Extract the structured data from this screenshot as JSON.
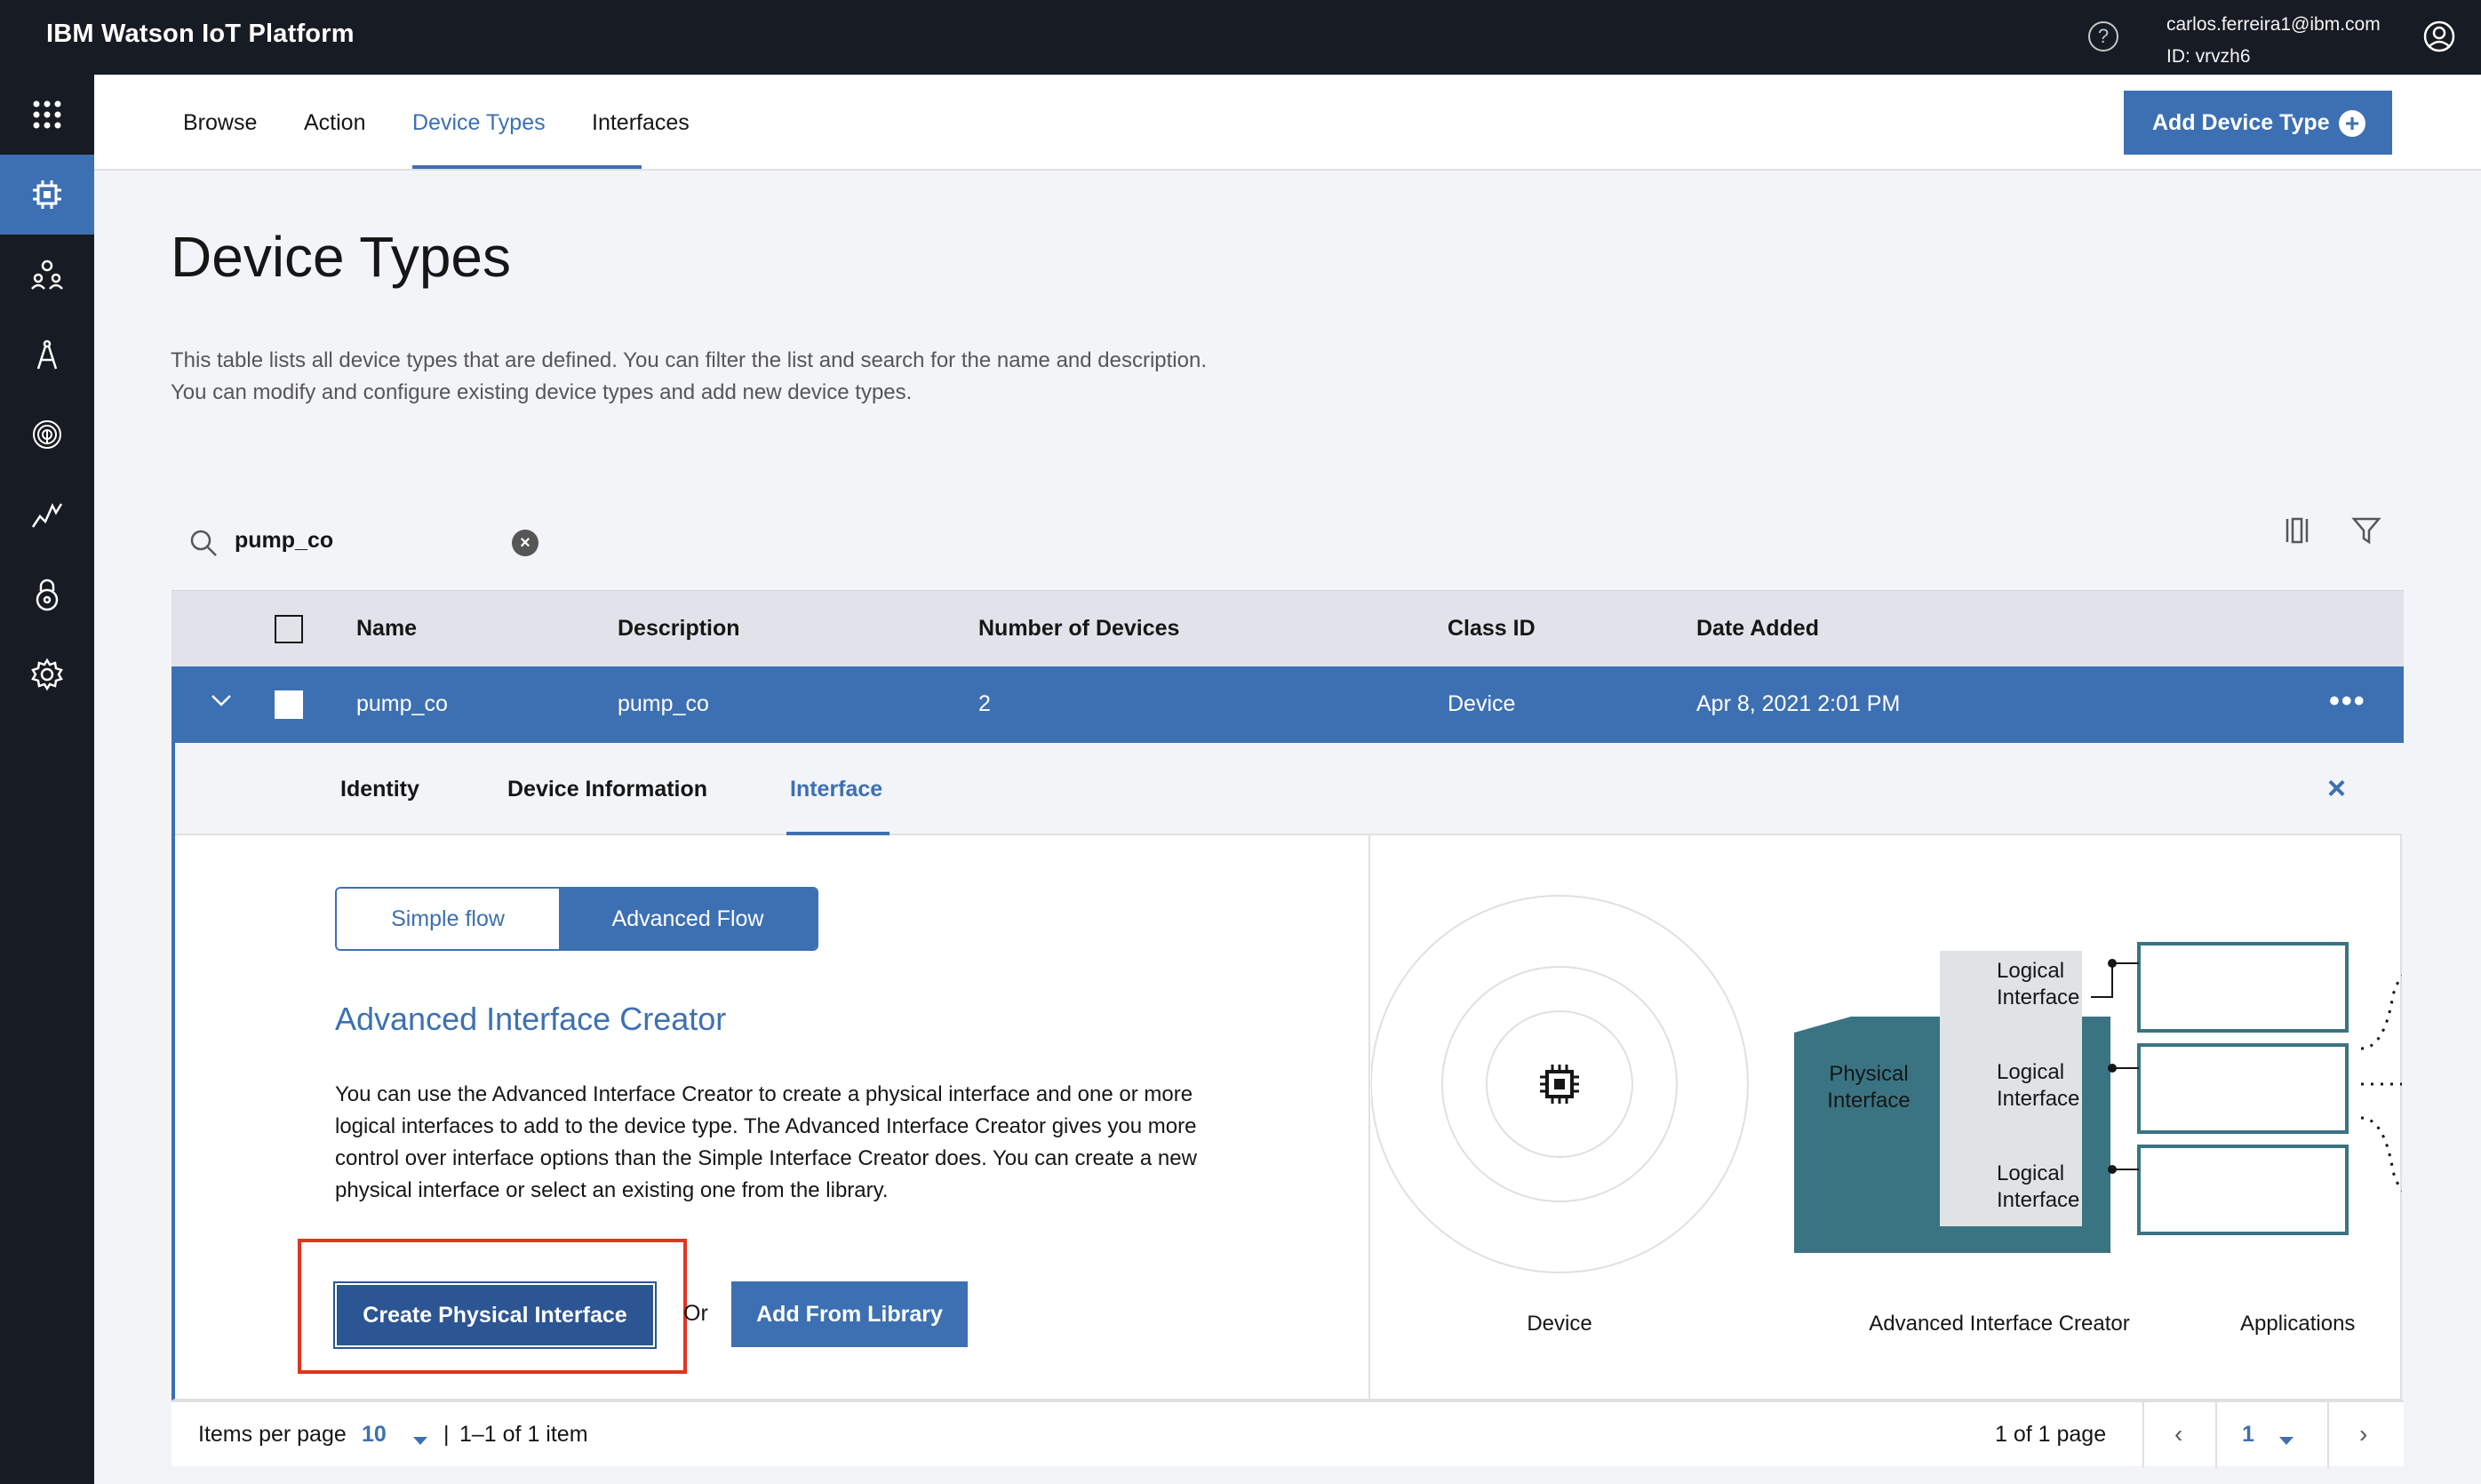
{
  "header": {
    "brand": "IBM Watson IoT Platform",
    "help_icon": "?",
    "user_email": "carlos.ferreira1@ibm.com",
    "user_id": "ID: vrvzh6"
  },
  "rail": {
    "items": [
      "apps-grid-icon",
      "devices-chip-icon",
      "members-icon",
      "apps-compass-icon",
      "security-fingerprint-icon",
      "usage-chart-icon",
      "lock-icon",
      "settings-gear-icon"
    ]
  },
  "subnav": {
    "tabs": [
      {
        "label": "Browse"
      },
      {
        "label": "Action"
      },
      {
        "label": "Device Types"
      },
      {
        "label": "Interfaces"
      }
    ],
    "add_button": "Add Device Type"
  },
  "page": {
    "title": "Device Types",
    "description_line1": "This table lists all device types that are defined. You can filter the list and search for the name and description.",
    "description_line2": "You can modify and configure existing device types and add new device types."
  },
  "search": {
    "value": "pump_co"
  },
  "table": {
    "headers": [
      "Name",
      "Description",
      "Number of Devices",
      "Class ID",
      "Date Added"
    ],
    "rows": [
      {
        "name": "pump_co",
        "description": "pump_co",
        "devices": "2",
        "class_id": "Device",
        "date_added": "Apr 8, 2021 2:01 PM",
        "menu": "•••"
      }
    ]
  },
  "panel": {
    "tabs": [
      "Identity",
      "Device Information",
      "Interface"
    ],
    "close": "×",
    "toggle": {
      "simple": "Simple flow",
      "advanced": "Advanced Flow"
    },
    "title": "Advanced Interface Creator",
    "body": "You can use the Advanced Interface Creator to create a physical interface and one or more logical interfaces to add to the device type. The Advanced Interface Creator gives you more control over interface options than the Simple Interface Creator does. You can create a new physical interface or select an existing one from the library.",
    "create_button": "Create Physical Interface",
    "or_text": "Or",
    "library_button": "Add From Library",
    "diagram": {
      "physical": "Physical Interface",
      "logical": [
        "Logical Interface",
        "Logical Interface",
        "Logical Interface"
      ],
      "captions": [
        "Device",
        "Advanced Interface Creator",
        "Applications"
      ]
    }
  },
  "pagination": {
    "items_per_page_label": "Items per page",
    "items_per_page": "10",
    "range": "1–1 of 1 item",
    "page_of": "1 of 1 page",
    "current_page": "1"
  },
  "colors": {
    "accent": "#3d70b2",
    "header_bg": "#171b23",
    "highlight": "#e1351f"
  }
}
